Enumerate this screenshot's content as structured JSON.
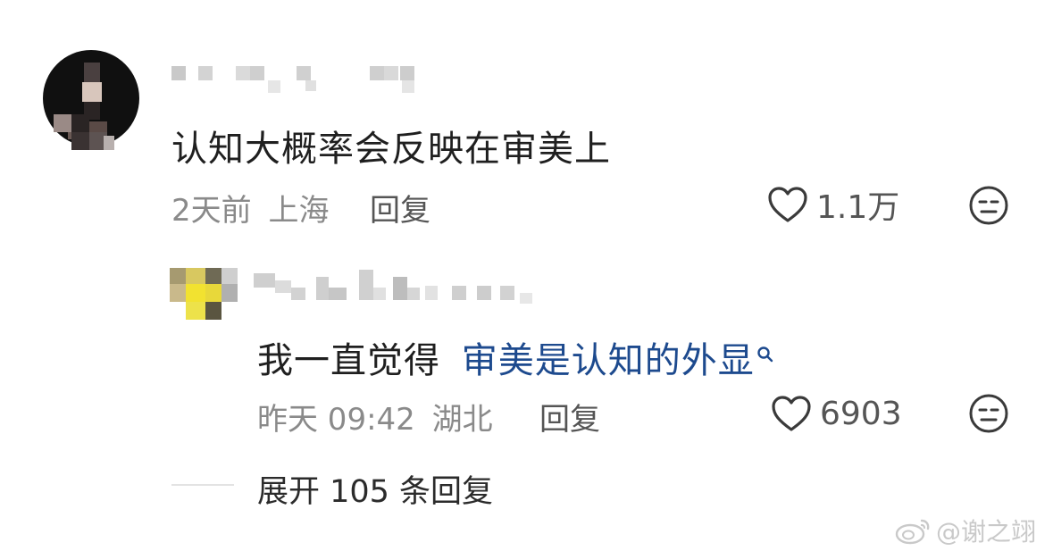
{
  "comments": [
    {
      "text": "认知大概率会反映在审美上",
      "time": "2天前",
      "location": "上海",
      "reply_label": "回复",
      "likes": "1.1万"
    }
  ],
  "reply": {
    "prefix": "我一直觉得",
    "link_text": "审美是认知的外显",
    "time": "昨天 09:42",
    "location": "湖北",
    "reply_label": "回复",
    "likes": "6903"
  },
  "expand_label": "展开 105 条回复",
  "watermark": "@谢之翊",
  "icons": {
    "like": "heart-outline-icon",
    "dislike": "meh-face-icon",
    "search": "search-icon",
    "weibo": "weibo-logo-icon"
  },
  "colors": {
    "link": "#1d4a8e",
    "meta": "#8a8a8a"
  }
}
